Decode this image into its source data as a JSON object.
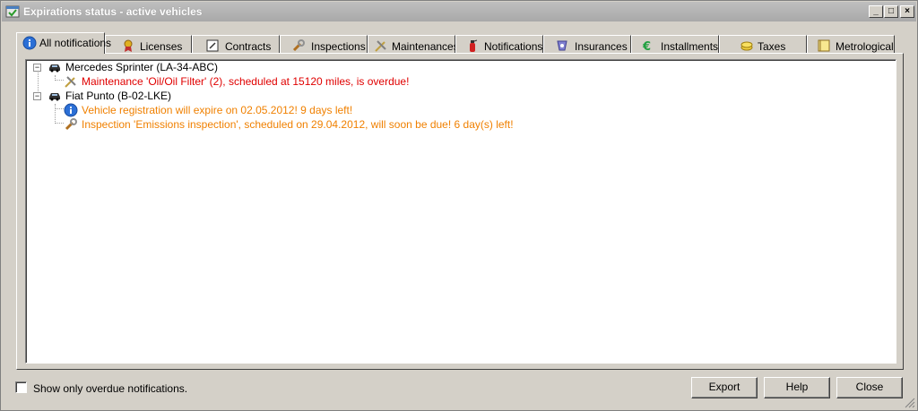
{
  "window": {
    "title": "Expirations status - active vehicles"
  },
  "window_buttons": {
    "minimize": "_",
    "maximize": "□",
    "close": "×"
  },
  "tabs": [
    {
      "label": "All notifications",
      "icon": "info-icon",
      "active": true
    },
    {
      "label": "Licenses",
      "icon": "license-icon"
    },
    {
      "label": "Contracts",
      "icon": "contract-icon"
    },
    {
      "label": "Inspections",
      "icon": "wrench-icon"
    },
    {
      "label": "Maintenances",
      "icon": "tools-icon"
    },
    {
      "label": "Notifications",
      "icon": "fire-extinguisher-icon"
    },
    {
      "label": "Insurances",
      "icon": "insurance-icon"
    },
    {
      "label": "Installments",
      "icon": "euro-icon"
    },
    {
      "label": "Taxes",
      "icon": "coins-icon"
    },
    {
      "label": "Metrological",
      "icon": "note-icon"
    }
  ],
  "tree": {
    "vehicles": [
      {
        "name": "Mercedes Sprinter (LA-34-ABC)",
        "expander": "−",
        "items": [
          {
            "text": "Maintenance 'Oil/Oil Filter' (2), scheduled at 15120 miles, is overdue!",
            "status": "overdue",
            "icon": "tools-icon"
          }
        ]
      },
      {
        "name": "Fiat Punto (B-02-LKE)",
        "expander": "−",
        "items": [
          {
            "text": "Vehicle registration will expire on 02.05.2012! 9 days left!",
            "status": "due-soon",
            "icon": "info-icon"
          },
          {
            "text": "Inspection 'Emissions inspection', scheduled on 29.04.2012, will soon be due! 6 day(s) left!",
            "status": "due-soon",
            "icon": "wrench-icon"
          }
        ]
      }
    ]
  },
  "footer": {
    "checkbox_label": "Show only overdue notifications.",
    "checked": false,
    "export_label": "Export",
    "help_label": "Help",
    "close_label": "Close"
  },
  "colors": {
    "overdue": "#e00000",
    "due_soon": "#f08000",
    "window_bg": "#d4d0c8"
  }
}
